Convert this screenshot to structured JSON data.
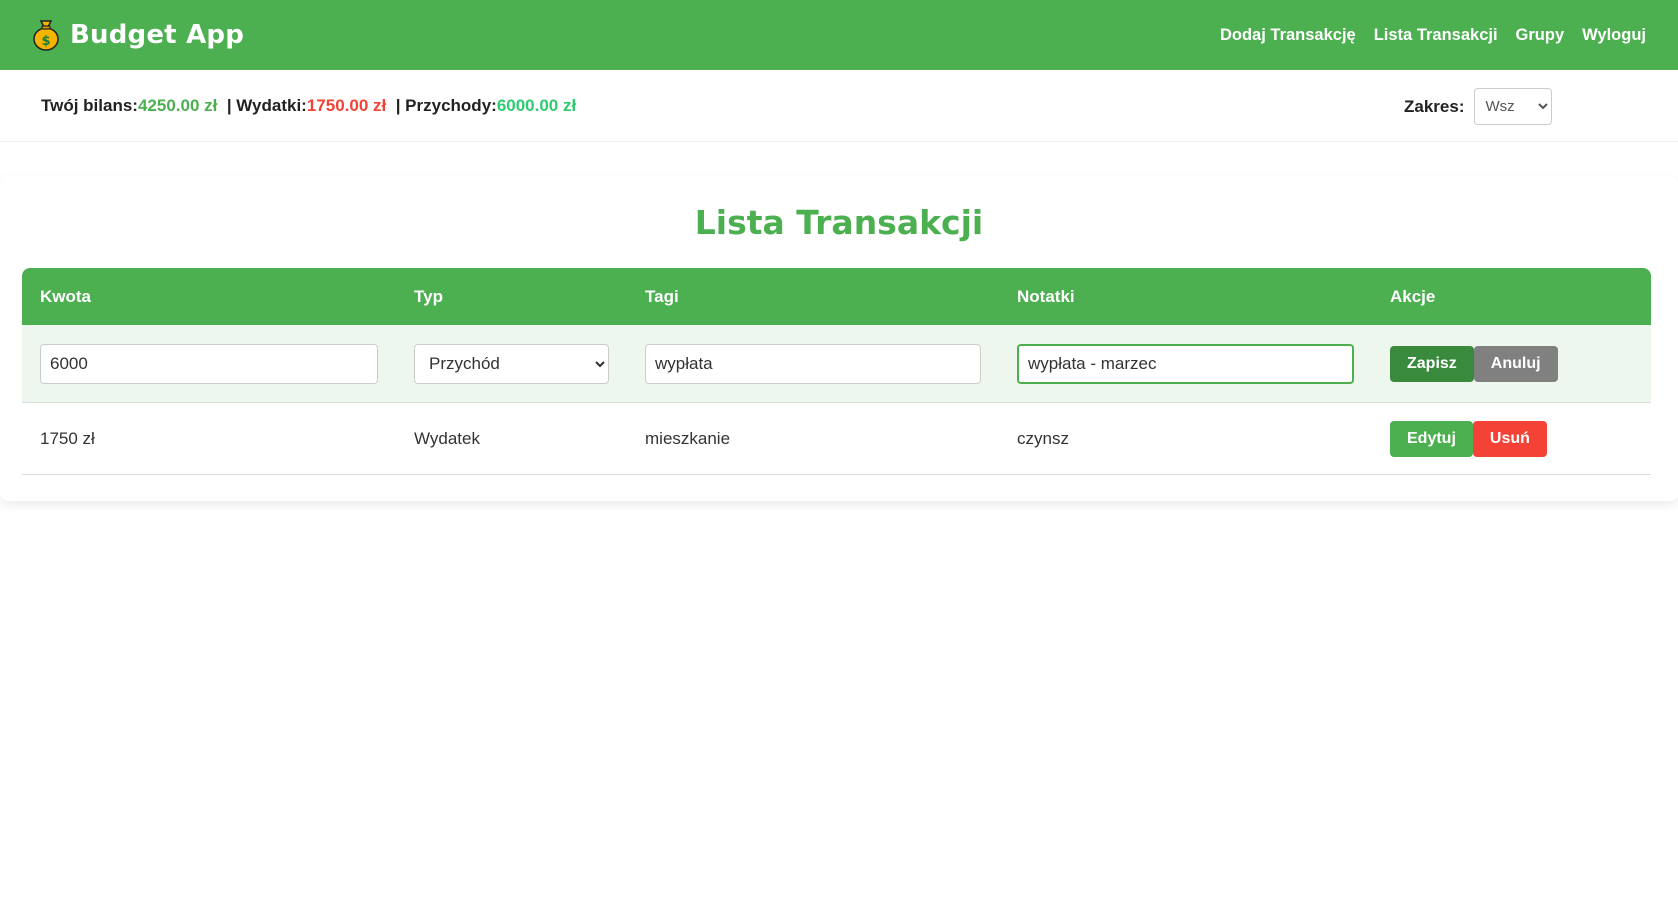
{
  "header": {
    "app_title": "Budget App",
    "logo_icon": "money-bag-icon",
    "nav": [
      {
        "label": "Dodaj Transakcję"
      },
      {
        "label": "Lista Transakcji"
      },
      {
        "label": "Grupy"
      },
      {
        "label": "Wyloguj"
      }
    ]
  },
  "balance": {
    "balance_label": "Twój bilans:",
    "balance_value": "4250.00 zł",
    "expenses_label": "  | Wydatki:",
    "expenses_value": "1750.00 zł",
    "income_label": "  | Przychody:",
    "income_value": "6000.00 zł",
    "range_label": "Zakres:",
    "range_value": "Wszystkie",
    "range_display": "Wsz"
  },
  "main": {
    "title": "Lista Transakcji",
    "columns": [
      "Kwota",
      "Typ",
      "Tagi",
      "Notatki",
      "Akcje"
    ],
    "edit_row": {
      "amount": "6000",
      "type": "Przychód",
      "tags": "wypłata",
      "notes": "wypłata - marzec",
      "save_label": "Zapisz",
      "cancel_label": "Anuluj"
    },
    "rows": [
      {
        "amount": "1750 zł",
        "type": "Wydatek",
        "tags": "mieszkanie",
        "notes": "czynsz",
        "edit_label": "Edytuj",
        "delete_label": "Usuń"
      }
    ]
  },
  "colors": {
    "primary": "#4caf50",
    "danger": "#f44336",
    "save": "#3a8a3e",
    "cancel": "#808080"
  }
}
